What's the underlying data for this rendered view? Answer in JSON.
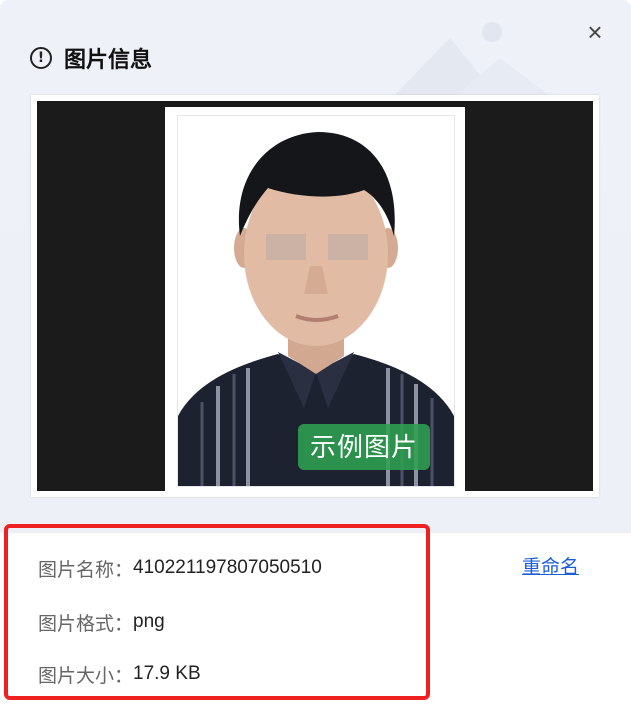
{
  "dialog": {
    "title": "图片信息",
    "close_label": "×",
    "info_icon": "!"
  },
  "preview": {
    "sample_badge": "示例图片"
  },
  "info": {
    "name_label": "图片名称：",
    "name_value": "410221197807050510",
    "format_label": "图片格式：",
    "format_value": "png",
    "size_label": "图片大小：",
    "size_value": "17.9 KB",
    "rename_label": "重命名"
  },
  "colors": {
    "highlight_border": "#ee2020",
    "link": "#1a5fd6",
    "badge_green": "#2ea050"
  }
}
